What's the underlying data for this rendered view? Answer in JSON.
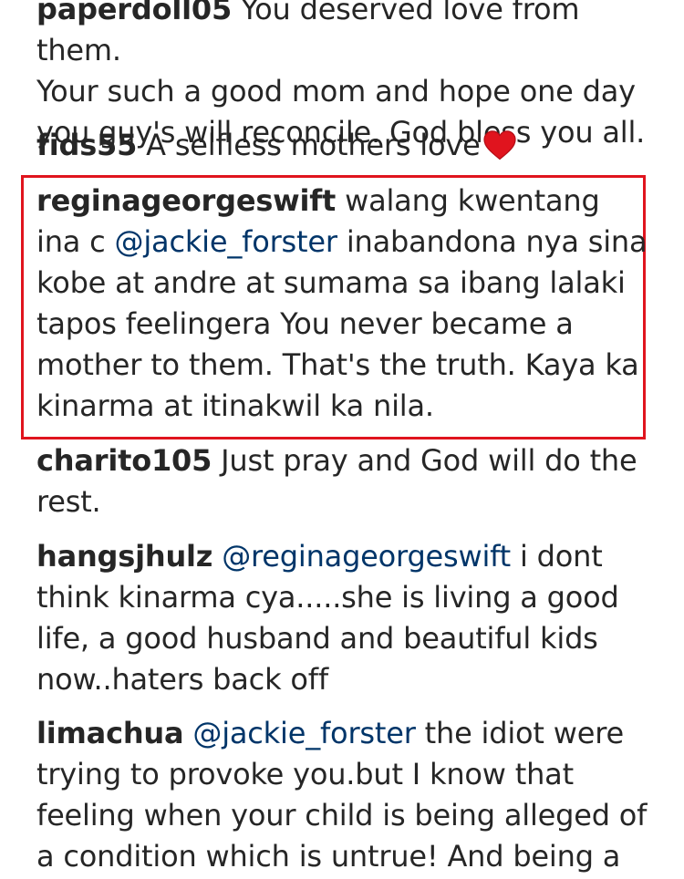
{
  "comments": [
    {
      "username": "paperdoll05",
      "lines": [
        "You deserved love from them.",
        "Your such a good mom and hope one day",
        "you guy's will reconcile. God bless you all."
      ]
    },
    {
      "username": "fids55",
      "text": "A selfless mothers love",
      "icon": "heart-icon",
      "icon_color": "#e0141e"
    },
    {
      "username": "reginageorgeswift",
      "text_before": "walang kwentang ina c",
      "mention": "@jackie_forster",
      "text_after": "inabandona nya sina kobe at andre at sumama sa ibang lalaki tapos feelingera You never became a mother to them. That's the truth. Kaya ka kinarma at itinakwil ka nila.",
      "highlighted": true,
      "highlight_color": "#e0141e"
    },
    {
      "username": "charito105",
      "text": "Just pray and God will do the rest."
    },
    {
      "username": "hangsjhulz",
      "mention": "@reginageorgeswift",
      "text_after": "i dont think kinarma cya.....she is living a good life, a good husband and beautiful kids now..haters back off"
    },
    {
      "username": "limachua",
      "mention": "@jackie_forster",
      "text_after": "the idiot were trying to provoke you.but I know that feeling when your child is being alleged of a condition which is untrue! And being a"
    }
  ],
  "colors": {
    "text": "#262626",
    "mention": "#003569",
    "highlight": "#e0141e"
  }
}
